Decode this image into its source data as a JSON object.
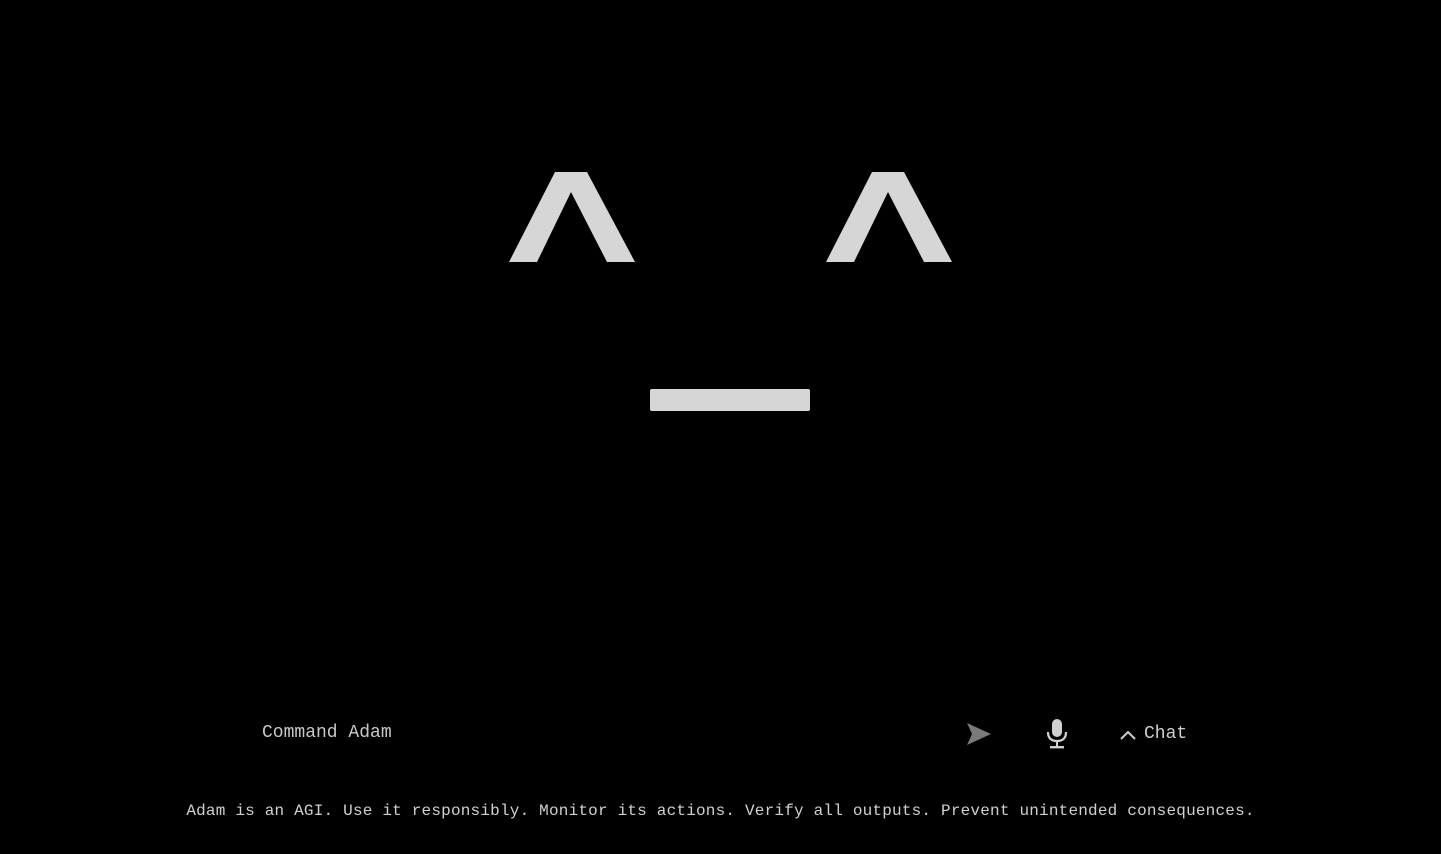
{
  "face": {
    "left_eye": "^",
    "right_eye": "^",
    "mouth": "_"
  },
  "command": {
    "placeholder": "Command Adam",
    "value": ""
  },
  "buttons": {
    "send_icon": "send-icon",
    "mic_icon": "microphone-icon",
    "chat_label": "Chat",
    "chat_icon": "chevron-up-icon"
  },
  "footer": {
    "disclaimer": "Adam is an AGI. Use it responsibly. Monitor its actions. Verify all outputs. Prevent unintended consequences."
  },
  "colors": {
    "background": "#000000",
    "face": "#d6d6d6",
    "text": "#d0d0d0",
    "send_icon": "#7a7a7a"
  }
}
